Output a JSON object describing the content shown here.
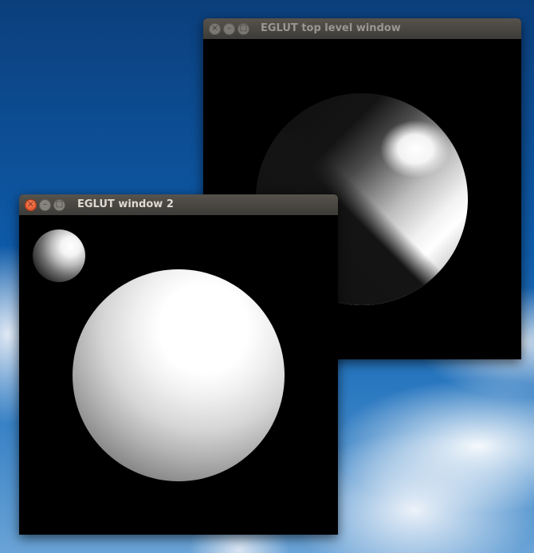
{
  "desktop": {
    "sky_color": "#0e5aa8",
    "cloud_color": "#f0f4fa"
  },
  "windows": [
    {
      "title": "EGLUT top level window",
      "focused": false,
      "controls": [
        "close-icon",
        "minimize-icon",
        "maximize-icon"
      ]
    },
    {
      "title": "EGLUT window 2",
      "focused": true,
      "controls": [
        "close-icon",
        "minimize-icon",
        "maximize-icon"
      ]
    }
  ],
  "glyphs": {
    "close": "×",
    "minimize": "–",
    "maximize": "□"
  },
  "colors": {
    "titlebar": "#3c3b37",
    "title_active": "#dfdbd2",
    "title_inactive": "#9a968f",
    "close_active": "#e9561f",
    "canvas": "#000000"
  }
}
